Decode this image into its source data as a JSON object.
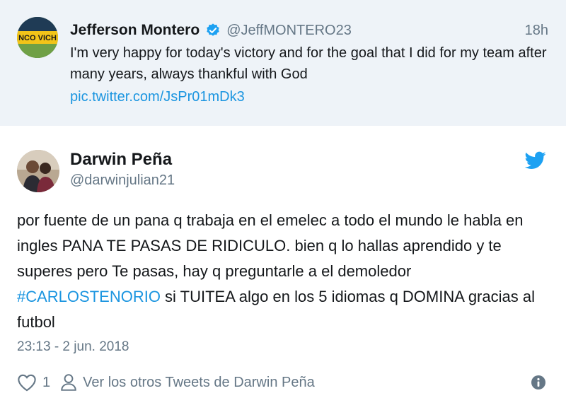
{
  "quoted_tweet": {
    "avatar": {
      "text": "NCO VICH",
      "bg": "#2f5a2a",
      "band": "#f2c419"
    },
    "name": "Jefferson Montero",
    "handle": "@JeffMONTERO23",
    "time": "18h",
    "text": "I'm very happy for today's victory and for the goal that I did for my team after many years, always thankful with God",
    "link": "pic.twitter.com/JsPr01mDk3",
    "verified_icon": "verified-badge-icon"
  },
  "tweet": {
    "name": "Darwin Peña",
    "handle": "@darwinjulian21",
    "text_parts": [
      {
        "type": "text",
        "value": "por fuente de un pana q trabaja en el emelec a todo el mundo le habla en ingles PANA TE PASAS DE RIDICULO. bien q lo hallas aprendido y te superes pero Te pasas, hay q preguntarle a el demoledor "
      },
      {
        "type": "hashtag",
        "value": "#CARLOSTENORIO"
      },
      {
        "type": "text",
        "value": " si TUITEA algo en los 5 idiomas q DOMINA gracias al futbol"
      }
    ],
    "date": "23:13 - 2 jun. 2018",
    "likes": "1",
    "more_tweets_label": "Ver los otros Tweets de Darwin Peña",
    "icons": [
      "twitter-bird-icon",
      "heart-icon",
      "person-icon",
      "info-icon"
    ]
  },
  "colors": {
    "link": "#1b95e0",
    "secondary_text": "#657786",
    "quoted_bg": "#eef3f8",
    "bird": "#1da1f2"
  }
}
